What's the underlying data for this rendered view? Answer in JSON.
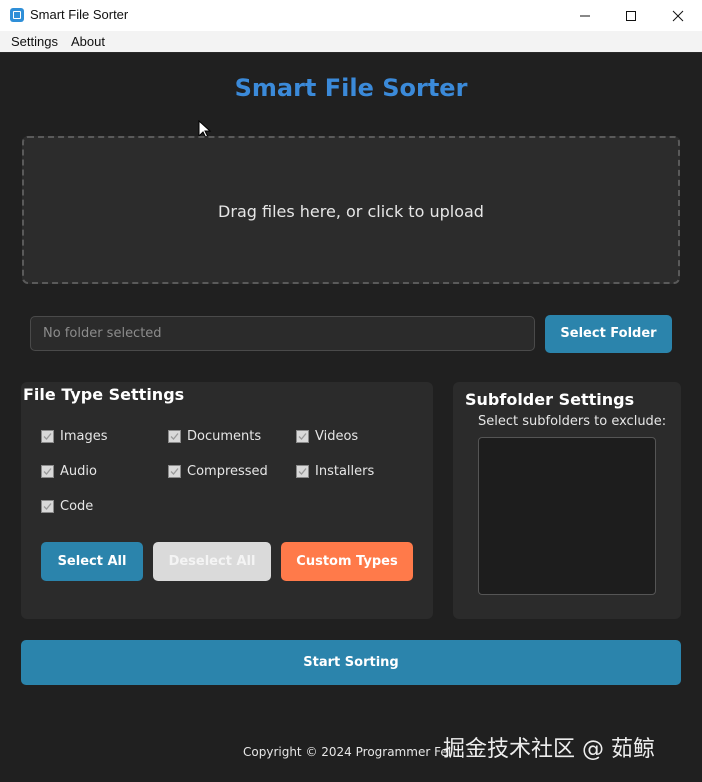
{
  "window": {
    "title": "Smart File Sorter",
    "controls": [
      "minimize-icon",
      "maximize-icon",
      "close-icon"
    ]
  },
  "menu": {
    "items": [
      "Settings",
      "About"
    ]
  },
  "header": {
    "title": "Smart File Sorter",
    "title_color": "#3b8ad9"
  },
  "dropzone": {
    "text": "Drag files here, or click to upload"
  },
  "folder": {
    "placeholder": "No folder selected",
    "select_button": "Select Folder"
  },
  "file_types": {
    "heading": "File Type Settings",
    "options": [
      {
        "label": "Images",
        "checked": true
      },
      {
        "label": "Documents",
        "checked": true
      },
      {
        "label": "Videos",
        "checked": true
      },
      {
        "label": "Audio",
        "checked": true
      },
      {
        "label": "Compressed",
        "checked": true
      },
      {
        "label": "Installers",
        "checked": true
      },
      {
        "label": "Code",
        "checked": true
      }
    ],
    "buttons": {
      "select_all": "Select All",
      "deselect_all": "Deselect All",
      "custom_types": "Custom Types"
    }
  },
  "subfolders": {
    "heading": "Subfolder Settings",
    "label": "Select subfolders to exclude:",
    "items": []
  },
  "actions": {
    "start": "Start Sorting"
  },
  "footer": {
    "copyright": "Copyright © 2024 Programmer Fei",
    "watermark": "掘金技术社区 @ 茹鲸"
  },
  "colors": {
    "accent_blue": "#2b84ac",
    "accent_orange": "#ff7a4a",
    "background": "#202020",
    "panel": "#2b2b2b"
  }
}
